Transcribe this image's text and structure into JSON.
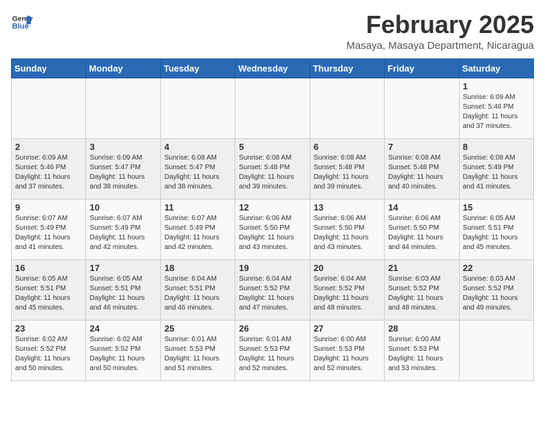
{
  "header": {
    "logo_general": "General",
    "logo_blue": "Blue",
    "month_year": "February 2025",
    "location": "Masaya, Masaya Department, Nicaragua"
  },
  "weekdays": [
    "Sunday",
    "Monday",
    "Tuesday",
    "Wednesday",
    "Thursday",
    "Friday",
    "Saturday"
  ],
  "weeks": [
    [
      {
        "day": "",
        "info": ""
      },
      {
        "day": "",
        "info": ""
      },
      {
        "day": "",
        "info": ""
      },
      {
        "day": "",
        "info": ""
      },
      {
        "day": "",
        "info": ""
      },
      {
        "day": "",
        "info": ""
      },
      {
        "day": "1",
        "info": "Sunrise: 6:09 AM\nSunset: 5:46 PM\nDaylight: 11 hours\nand 37 minutes."
      }
    ],
    [
      {
        "day": "2",
        "info": "Sunrise: 6:09 AM\nSunset: 5:46 PM\nDaylight: 11 hours\nand 37 minutes."
      },
      {
        "day": "3",
        "info": "Sunrise: 6:09 AM\nSunset: 5:47 PM\nDaylight: 11 hours\nand 38 minutes."
      },
      {
        "day": "4",
        "info": "Sunrise: 6:08 AM\nSunset: 5:47 PM\nDaylight: 11 hours\nand 38 minutes."
      },
      {
        "day": "5",
        "info": "Sunrise: 6:08 AM\nSunset: 5:48 PM\nDaylight: 11 hours\nand 39 minutes."
      },
      {
        "day": "6",
        "info": "Sunrise: 6:08 AM\nSunset: 5:48 PM\nDaylight: 11 hours\nand 39 minutes."
      },
      {
        "day": "7",
        "info": "Sunrise: 6:08 AM\nSunset: 5:48 PM\nDaylight: 11 hours\nand 40 minutes."
      },
      {
        "day": "8",
        "info": "Sunrise: 6:08 AM\nSunset: 5:49 PM\nDaylight: 11 hours\nand 41 minutes."
      }
    ],
    [
      {
        "day": "9",
        "info": "Sunrise: 6:07 AM\nSunset: 5:49 PM\nDaylight: 11 hours\nand 41 minutes."
      },
      {
        "day": "10",
        "info": "Sunrise: 6:07 AM\nSunset: 5:49 PM\nDaylight: 11 hours\nand 42 minutes."
      },
      {
        "day": "11",
        "info": "Sunrise: 6:07 AM\nSunset: 5:49 PM\nDaylight: 11 hours\nand 42 minutes."
      },
      {
        "day": "12",
        "info": "Sunrise: 6:06 AM\nSunset: 5:50 PM\nDaylight: 11 hours\nand 43 minutes."
      },
      {
        "day": "13",
        "info": "Sunrise: 6:06 AM\nSunset: 5:50 PM\nDaylight: 11 hours\nand 43 minutes."
      },
      {
        "day": "14",
        "info": "Sunrise: 6:06 AM\nSunset: 5:50 PM\nDaylight: 11 hours\nand 44 minutes."
      },
      {
        "day": "15",
        "info": "Sunrise: 6:05 AM\nSunset: 5:51 PM\nDaylight: 11 hours\nand 45 minutes."
      }
    ],
    [
      {
        "day": "16",
        "info": "Sunrise: 6:05 AM\nSunset: 5:51 PM\nDaylight: 11 hours\nand 45 minutes."
      },
      {
        "day": "17",
        "info": "Sunrise: 6:05 AM\nSunset: 5:51 PM\nDaylight: 11 hours\nand 46 minutes."
      },
      {
        "day": "18",
        "info": "Sunrise: 6:04 AM\nSunset: 5:51 PM\nDaylight: 11 hours\nand 46 minutes."
      },
      {
        "day": "19",
        "info": "Sunrise: 6:04 AM\nSunset: 5:52 PM\nDaylight: 11 hours\nand 47 minutes."
      },
      {
        "day": "20",
        "info": "Sunrise: 6:04 AM\nSunset: 5:52 PM\nDaylight: 11 hours\nand 48 minutes."
      },
      {
        "day": "21",
        "info": "Sunrise: 6:03 AM\nSunset: 5:52 PM\nDaylight: 11 hours\nand 48 minutes."
      },
      {
        "day": "22",
        "info": "Sunrise: 6:03 AM\nSunset: 5:52 PM\nDaylight: 11 hours\nand 49 minutes."
      }
    ],
    [
      {
        "day": "23",
        "info": "Sunrise: 6:02 AM\nSunset: 5:52 PM\nDaylight: 11 hours\nand 50 minutes."
      },
      {
        "day": "24",
        "info": "Sunrise: 6:02 AM\nSunset: 5:52 PM\nDaylight: 11 hours\nand 50 minutes."
      },
      {
        "day": "25",
        "info": "Sunrise: 6:01 AM\nSunset: 5:53 PM\nDaylight: 11 hours\nand 51 minutes."
      },
      {
        "day": "26",
        "info": "Sunrise: 6:01 AM\nSunset: 5:53 PM\nDaylight: 11 hours\nand 52 minutes."
      },
      {
        "day": "27",
        "info": "Sunrise: 6:00 AM\nSunset: 5:53 PM\nDaylight: 11 hours\nand 52 minutes."
      },
      {
        "day": "28",
        "info": "Sunrise: 6:00 AM\nSunset: 5:53 PM\nDaylight: 11 hours\nand 53 minutes."
      },
      {
        "day": "",
        "info": ""
      }
    ]
  ]
}
